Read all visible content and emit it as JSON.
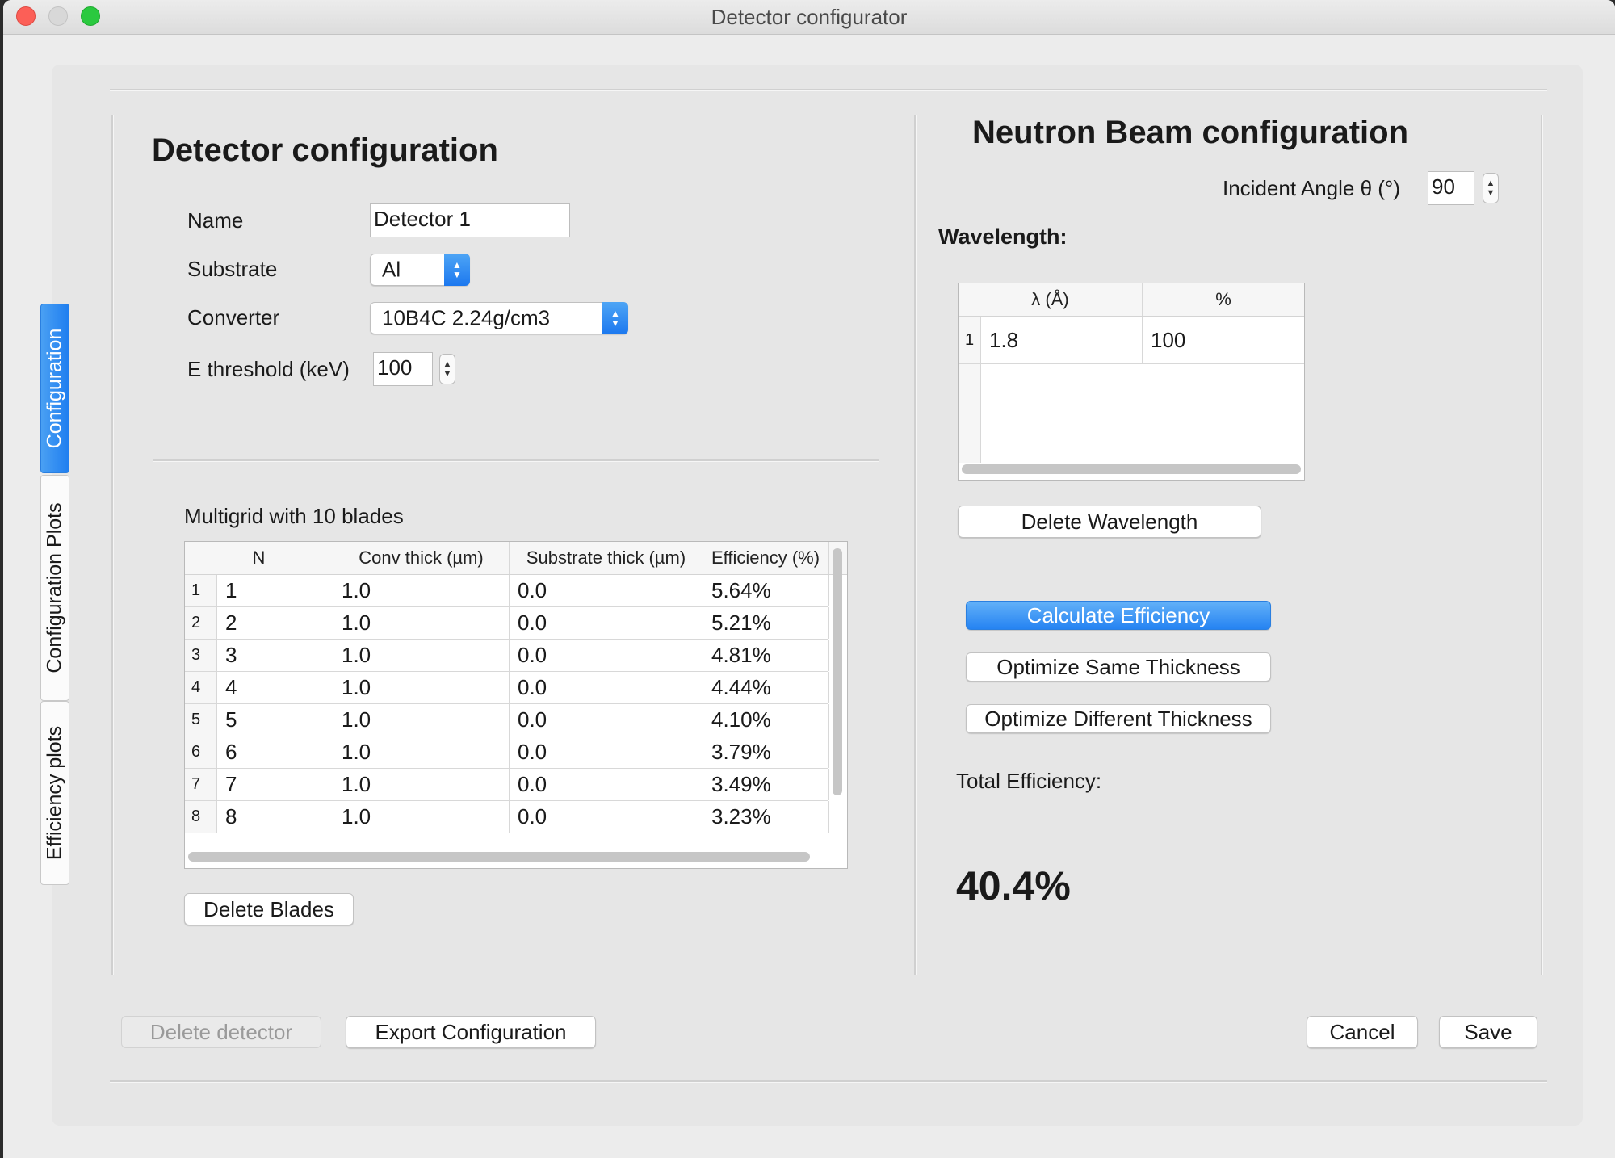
{
  "window": {
    "title": "Detector configurator"
  },
  "tabs": [
    "Configuration",
    "Configuration Plots",
    "Efficiency plots"
  ],
  "detector": {
    "heading": "Detector configuration",
    "name_label": "Name",
    "name_value": "Detector 1",
    "substrate_label": "Substrate",
    "substrate_value": "Al",
    "converter_label": "Converter",
    "converter_value": "10B4C 2.24g/cm3",
    "ethreshold_label": "E threshold (keV)",
    "ethreshold_value": "100",
    "blades_caption": "Multigrid with 10 blades",
    "blades_table": {
      "headers": [
        "N",
        "Conv thick (µm)",
        "Substrate thick (µm)",
        "Efficiency (%)"
      ],
      "rows": [
        {
          "row": "1",
          "n": "1",
          "conv": "1.0",
          "sub": "0.0",
          "eff": "5.64%"
        },
        {
          "row": "2",
          "n": "2",
          "conv": "1.0",
          "sub": "0.0",
          "eff": "5.21%"
        },
        {
          "row": "3",
          "n": "3",
          "conv": "1.0",
          "sub": "0.0",
          "eff": "4.81%"
        },
        {
          "row": "4",
          "n": "4",
          "conv": "1.0",
          "sub": "0.0",
          "eff": "4.44%"
        },
        {
          "row": "5",
          "n": "5",
          "conv": "1.0",
          "sub": "0.0",
          "eff": "4.10%"
        },
        {
          "row": "6",
          "n": "6",
          "conv": "1.0",
          "sub": "0.0",
          "eff": "3.79%"
        },
        {
          "row": "7",
          "n": "7",
          "conv": "1.0",
          "sub": "0.0",
          "eff": "3.49%"
        },
        {
          "row": "8",
          "n": "8",
          "conv": "1.0",
          "sub": "0.0",
          "eff": "3.23%"
        }
      ]
    },
    "delete_blades": "Delete Blades"
  },
  "beam": {
    "heading": "Neutron Beam configuration",
    "angle_label": "Incident Angle θ (°)",
    "angle_value": "90",
    "wavelength_label": "Wavelength:",
    "wavelength_table": {
      "headers": [
        "λ (Å)",
        "%"
      ],
      "rows": [
        {
          "row": "1",
          "lambda": "1.8",
          "percent": "100"
        }
      ]
    },
    "delete_wavelength": "Delete Wavelength",
    "calculate": "Calculate Efficiency",
    "optimize_same": "Optimize Same Thickness",
    "optimize_diff": "Optimize Different Thickness",
    "total_label": "Total Efficiency:",
    "total_value": "40.4%"
  },
  "footer": {
    "delete_detector": "Delete detector",
    "export": "Export Configuration",
    "cancel": "Cancel",
    "save": "Save"
  },
  "colors": {
    "accent": "#2583f2",
    "window_bg": "#ececec"
  }
}
